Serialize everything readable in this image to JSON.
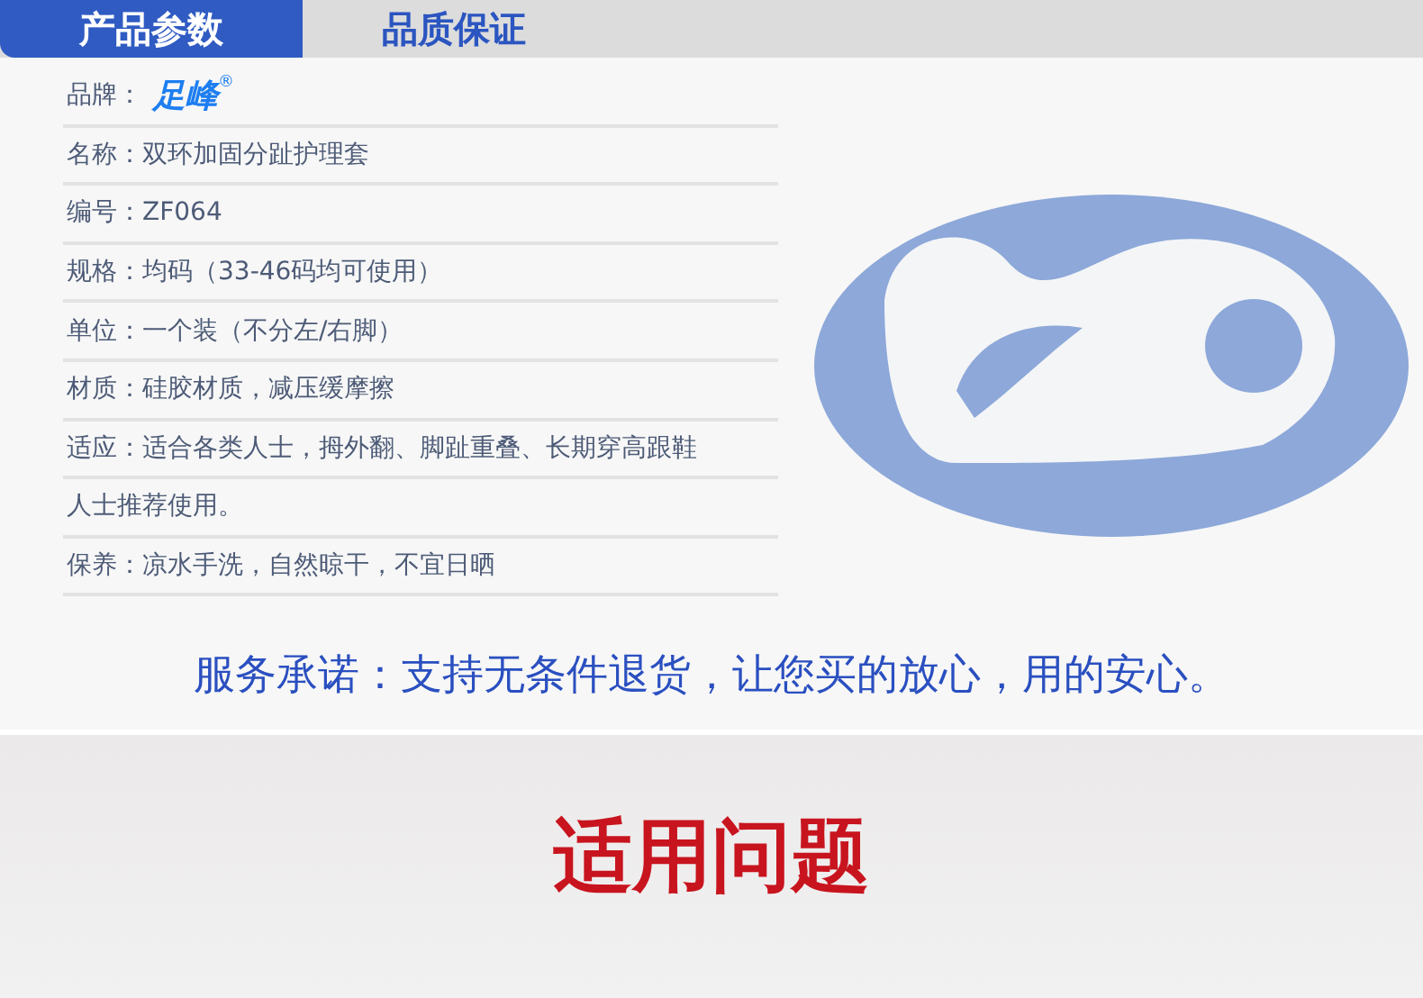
{
  "tabs": [
    {
      "label": "产品参数",
      "selected": true
    },
    {
      "label": "品质保证",
      "selected": false
    }
  ],
  "specs": [
    {
      "kind": "logo",
      "label": "品牌：",
      "logo": "足峰",
      "mark": "®"
    },
    {
      "kind": "text",
      "text": "名称：双环加固分趾护理套"
    },
    {
      "kind": "text",
      "text": "编号：ZF064"
    },
    {
      "kind": "text",
      "text": "规格：均码（33-46码均可使用）"
    },
    {
      "kind": "text",
      "text": "单位：一个装（不分左/右脚）"
    },
    {
      "kind": "text",
      "text": "材质：硅胶材质，减压缓摩擦"
    },
    {
      "kind": "text",
      "text": "适应：适合各类人士，拇外翻、脚趾重叠、长期穿高跟鞋"
    },
    {
      "kind": "text",
      "text": "人士推荐使用。"
    },
    {
      "kind": "text",
      "text": "保养：凉水手洗，自然晾干，不宜日晒"
    }
  ],
  "service": "服务承诺：支持无条件退货，让您买的放心，用的安心。",
  "section_title": "适用问题"
}
